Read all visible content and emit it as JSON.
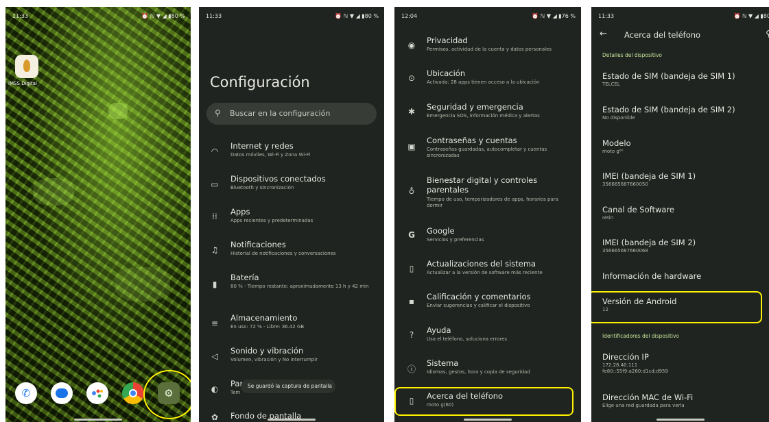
{
  "home": {
    "time": "11:33",
    "status_icons": "⏰ ℕ ▼ ◢ ▮80 %",
    "app_label": "IMSS Digital"
  },
  "settings": {
    "time": "11:33",
    "status_icons": "⏰ ℕ ▼ ◢ ▮80 %",
    "title": "Configuración",
    "search_placeholder": "Buscar en la configuración",
    "items": [
      {
        "title": "Internet y redes",
        "subtitle": "Datos móviles, Wi-Fi y Zona Wi-Fi"
      },
      {
        "title": "Dispositivos conectados",
        "subtitle": "Bluetooth y sincronización"
      },
      {
        "title": "Apps",
        "subtitle": "Apps recientes y predeterminadas"
      },
      {
        "title": "Notificaciones",
        "subtitle": "Historial de notificaciones y conversaciones"
      },
      {
        "title": "Batería",
        "subtitle": "80 % - Tiempo restante: aproximadamente 13 h y 42 min"
      },
      {
        "title": "Almacenamiento",
        "subtitle": "En uso: 72 % - Libre: 36.42 GB"
      },
      {
        "title": "Sonido y vibración",
        "subtitle": "Volumen, vibración y No interrumpir"
      },
      {
        "title": "Par",
        "subtitle": "Tem"
      },
      {
        "title": "Fondo de pantalla",
        "subtitle": ""
      }
    ],
    "toast": "Se guardó la captura de pantalla"
  },
  "settings2": {
    "time": "12:04",
    "status_icons": "⏰ ℕ ▼ ◢ ▮76 %",
    "items": [
      {
        "title": "Privacidad",
        "subtitle": "Permisos, actividad de la cuenta y datos personales"
      },
      {
        "title": "Ubicación",
        "subtitle": "Activada: 28 apps tienen acceso a la ubicación"
      },
      {
        "title": "Seguridad y emergencia",
        "subtitle": "Emergencia SOS, información médica y alertas"
      },
      {
        "title": "Contraseñas y cuentas",
        "subtitle": "Contraseñas guardadas, autocompletar y cuentas sincronizadas"
      },
      {
        "title": "Bienestar digital y controles parentales",
        "subtitle": "Tiempo de uso, temporizadores de apps, horarios para dormir"
      },
      {
        "title": "Google",
        "subtitle": "Servicios y preferencias"
      },
      {
        "title": "Actualizaciones del sistema",
        "subtitle": "Actualizar a la versión de software más reciente"
      },
      {
        "title": "Calificación y comentarios",
        "subtitle": "Enviar sugerencias y calificar el dispositivo"
      },
      {
        "title": "Ayuda",
        "subtitle": "Usa el teléfono, soluciona errores"
      },
      {
        "title": "Sistema",
        "subtitle": "Idiomas, gestos, hora y copia de seguridad"
      },
      {
        "title": "Acerca del teléfono",
        "subtitle": "moto g(60)"
      }
    ]
  },
  "about": {
    "time": "11:33",
    "status_icons": "⏰ ℕ ▼ ◢ ▮80",
    "title": "Acerca del teléfono",
    "section_device": "Detalles del dispositivo",
    "items": [
      {
        "title": "Estado de SIM (bandeja de SIM 1)",
        "subtitle": "TELCEL"
      },
      {
        "title": "Estado de SIM (bandeja de SIM 2)",
        "subtitle": "No disponible"
      },
      {
        "title": "Modelo",
        "subtitle": "moto g⁶⁰"
      },
      {
        "title": "IMEI (bandeja de SIM 1)",
        "subtitle": "356665687660050"
      },
      {
        "title": "Canal de Software",
        "subtitle": "retin"
      },
      {
        "title": "IMEI (bandeja de SIM 2)",
        "subtitle": "356665687660068"
      },
      {
        "title": "Información de hardware",
        "subtitle": ""
      },
      {
        "title": "Versión de Android",
        "subtitle": "12"
      }
    ],
    "section_ids": "Identificadores del dispositivo",
    "ip_title": "Dirección IP",
    "ip_line1": "172.28.40.111",
    "ip_line2": "fe80::55f9:a260:d1cd:d959",
    "mac_title": "Dirección MAC de Wi-Fi",
    "mac_subtitle": "Elige una red guardada para verla"
  },
  "colors": {
    "highlight": "#fff200",
    "background": "#1f2420",
    "accent_green": "#c7e49a"
  },
  "icons": [
    "wifi-icon",
    "devices-icon",
    "apps-icon",
    "bell-icon",
    "battery-icon",
    "storage-icon",
    "sound-icon",
    "display-icon",
    "wallpaper-icon",
    "privacy-icon",
    "location-icon",
    "security-icon",
    "password-icon",
    "wellbeing-icon",
    "google-icon",
    "update-icon",
    "feedback-icon",
    "help-icon",
    "system-icon",
    "phone-icon",
    "back-icon",
    "search-icon"
  ]
}
